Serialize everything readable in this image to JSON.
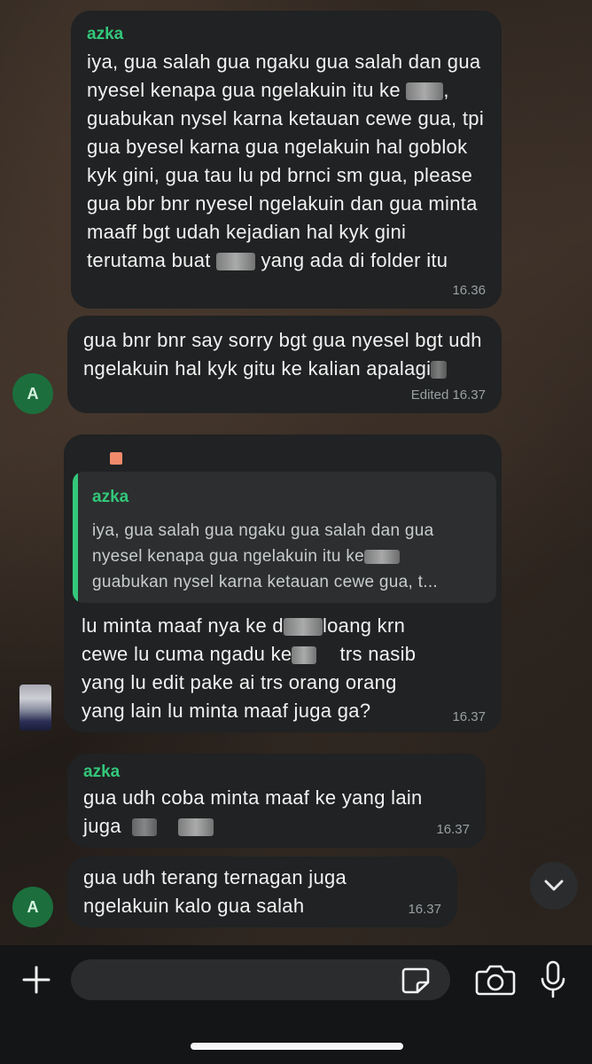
{
  "messages": [
    {
      "sender": "azka",
      "text_parts": [
        "iya, gua salah gua ngaku gua salah dan gua nyesel kenapa gua ngelakuin itu ke ",
        ", guabukan nysel karna ketauan cewe gua, tpi gua byesel karna gua ngelakuin hal goblok kyk gini, gua tau lu pd brnci sm gua, please gua bbr bnr nyesel ngelakuin dan gua minta maaff bgt udah kejadian hal kyk gini terutama buat ",
        " yang ada di folder itu"
      ],
      "time": "16.36"
    },
    {
      "text": "gua bnr bnr say sorry bgt gua nyesel bgt udh ngelakuin hal kyk gitu ke kalian apalagi",
      "time": "Edited 16.37",
      "avatar_letter": "A"
    },
    {
      "quote_sender": "azka",
      "quote_text_1": "iya, gua salah gua ngaku gua salah dan gua",
      "quote_text_2": "nyesel kenapa gua ngelakuin itu ke",
      "quote_text_3": "guabukan nysel karna ketauan cewe gua, t...",
      "text_1": "lu minta maaf nya ke d",
      "text_2": "loang krn",
      "text_3": "cewe lu cuma ngadu ke",
      "text_4": "trs nasib",
      "text_5": "yang lu edit pake ai trs orang orang",
      "text_6": "yang lain lu minta maaf juga ga?",
      "time": "16.37"
    },
    {
      "sender": "azka",
      "text_1": "gua udh coba minta maaf ke yang lain",
      "text_2": "juga",
      "time": "16.37"
    },
    {
      "text_1": "gua udh terang ternagan juga",
      "text_2": "ngelakuin kalo gua salah",
      "time": "16.37",
      "avatar_letter": "A"
    }
  ],
  "composer": {
    "placeholder": ""
  },
  "colors": {
    "bubble": "#202223",
    "sender": "#33c77a",
    "avatar": "#1c6f3d"
  },
  "icons": [
    "plus-icon",
    "sticker-icon",
    "camera-icon",
    "microphone-icon",
    "chevron-down-icon"
  ]
}
